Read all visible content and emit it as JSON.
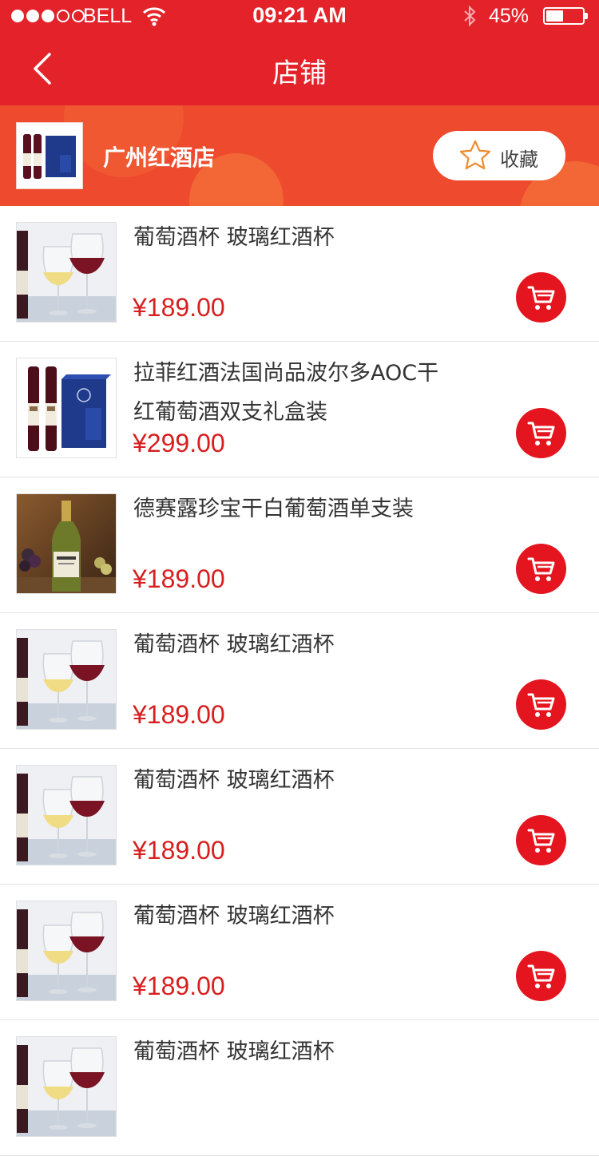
{
  "status_bar": {
    "signal_dots_on": 3,
    "signal_dots_total": 5,
    "carrier": "BELL",
    "time": "09:21 AM",
    "battery_percent": "45%",
    "battery_level": 0.45
  },
  "nav": {
    "title": "店铺",
    "back_icon": "chevron-left-icon"
  },
  "shop": {
    "name": "广州红酒店",
    "favorite_label": "收藏",
    "favorite_icon": "star-outline-icon"
  },
  "products": [
    {
      "name": "葡萄酒杯 玻璃红酒杯",
      "price": "¥189.00",
      "image": "glasses"
    },
    {
      "name": "拉菲红酒法国尚品波尔多AOC干红葡萄酒双支礼盒装",
      "price": "¥299.00",
      "image": "giftbox"
    },
    {
      "name": "德赛露珍宝干白葡萄酒单支装",
      "price": "¥189.00",
      "image": "whitewine"
    },
    {
      "name": "葡萄酒杯 玻璃红酒杯",
      "price": "¥189.00",
      "image": "glasses"
    },
    {
      "name": "葡萄酒杯 玻璃红酒杯",
      "price": "¥189.00",
      "image": "glasses"
    },
    {
      "name": "葡萄酒杯 玻璃红酒杯",
      "price": "¥189.00",
      "image": "glasses"
    },
    {
      "name": "葡萄酒杯 玻璃红酒杯",
      "price": "",
      "image": "glasses"
    }
  ],
  "colors": {
    "brand_red": "#e4222a",
    "price_red": "#d81e1e",
    "cart_red": "#e4151e",
    "shop_banner": "#ee4a2e",
    "star_orange": "#f08a2a"
  }
}
